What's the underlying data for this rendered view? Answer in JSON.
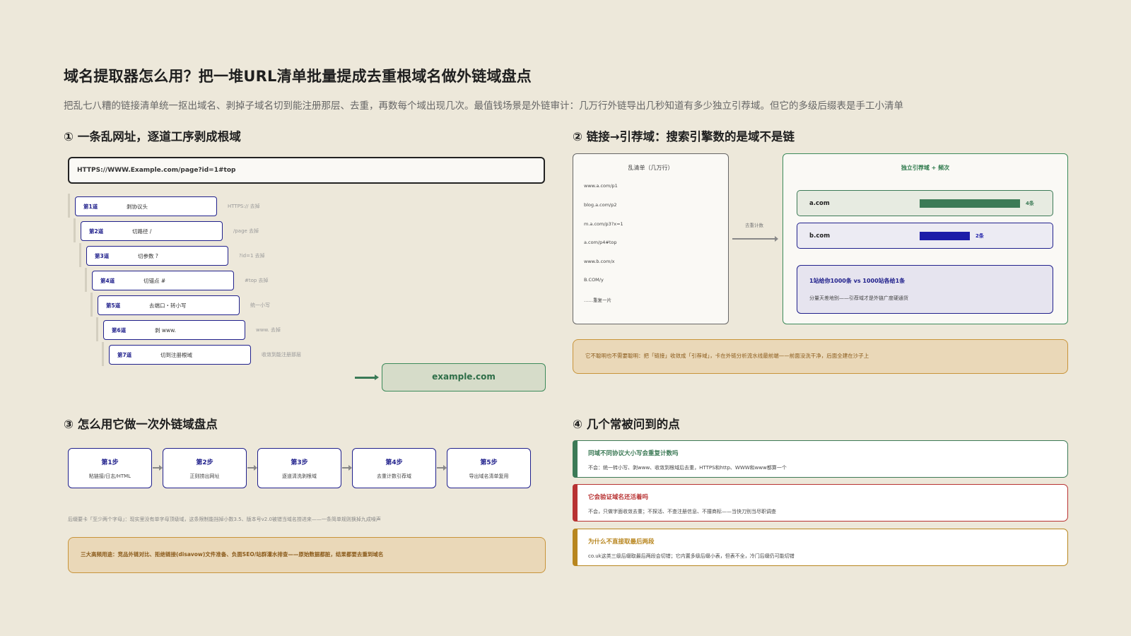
{
  "title": "域名提取器怎么用？把一堆URL清单批量提成去重根域名做外链域盘点",
  "subtitle": "把乱七八糟的链接清单统一抠出域名、剥掉子域名切到能注册那层、去重，再数每个域出现几次。最值钱场景是外链审计：几万行外链导出几秒知道有多少独立引荐域。但它的多级后缀表是手工小清单",
  "section1": {
    "title": "① 一条乱网址，逐道工序剥成根域",
    "input_url": "HTTPS://WWW.Example.com/page?id=1#top",
    "steps": [
      {
        "name": "第1道",
        "action": "剥协议头",
        "note": "HTTPS:// 去掉"
      },
      {
        "name": "第2道",
        "action": "切路径 /",
        "note": "/page 去掉"
      },
      {
        "name": "第3道",
        "action": "切参数 ?",
        "note": "?id=1 去掉"
      },
      {
        "name": "第4道",
        "action": "切锚点 #",
        "note": "#top 去掉"
      },
      {
        "name": "第5道",
        "action": "去端口・转小写",
        "note": "统一小写"
      },
      {
        "name": "第6道",
        "action": "剥 www.",
        "note": "www. 去掉"
      },
      {
        "name": "第7道",
        "action": "切到注册根域",
        "note": "收敛到能注册那层"
      }
    ],
    "result": "example.com"
  },
  "section2": {
    "title": "② 链接→引荐域：搜索引擎数的是域不是链",
    "list_header": "乱清单（几万行）",
    "list_items": [
      "www.a.com/p1",
      "blog.a.com/p2",
      "m.a.com/p3?x=1",
      "a.com/p4#top",
      "www.b.com/x",
      "B.COM/y",
      "……重复一片"
    ],
    "mid_label": "去重计数",
    "domain_header": "独立引荐域 + 频次",
    "domains": [
      {
        "name": "a.com",
        "count": 4,
        "count_label": "4条",
        "color": "#3c7a56"
      },
      {
        "name": "b.com",
        "count": 2,
        "count_label": "2条",
        "color": "#1c1ca8"
      }
    ],
    "callout_title": "1站给你1000条 vs 1000站各给1条",
    "callout_body": "分量天差地别——引荐域才是外链广度硬通货",
    "warning": "它不聪明也不需要聪明：把「链接」收敛成「引荐域」，卡在外链分析流水线最前端——前面没洗干净，后面全建在沙子上"
  },
  "section3": {
    "title": "③ 怎么用它做一次外链域盘点",
    "steps": [
      {
        "step": "第1步",
        "desc": "粘链接/日志/HTML"
      },
      {
        "step": "第2步",
        "desc": "正则捞出网址"
      },
      {
        "step": "第3步",
        "desc": "逐道清洗剥根域"
      },
      {
        "step": "第4步",
        "desc": "去重计数引荐域"
      },
      {
        "step": "第5步",
        "desc": "导出域名清单复用"
      }
    ],
    "note": "后缀要卡「至少两个字母」：现实里没有单字母顶级域，这条限制能挡掉小数3.5、版本号v2.0被错当域名捞进来——一条简单规则换掉九成噪声",
    "usage": "三大高频用途：竞品外链对比、拒绝链接(disavow)文件准备、负面SEO/站群灌水排查——原始数据都脏，结果都要去重到域名"
  },
  "section4": {
    "title": "④ 几个常被问到的点",
    "faqs": [
      {
        "q": "同域不同协议大小写会重复计数吗",
        "a": "不会：统一转小写、剥www、收敛到根域后去重，HTTPS和http、WWW和www都算一个",
        "color": "#3c7a56"
      },
      {
        "q": "它会验证域名还活着吗",
        "a": "不会，只做字面收敛去重；不探活、不查注册信息、不撞商标——当快刀别当尽职调查",
        "color": "#b83232"
      },
      {
        "q": "为什么不直接取最后两段",
        "a": "co.uk这类三级后缀取最后两段会切错；它内置多级后缀小表，但表不全，冷门后缀仍可能切错",
        "color": "#b8861f"
      }
    ]
  }
}
